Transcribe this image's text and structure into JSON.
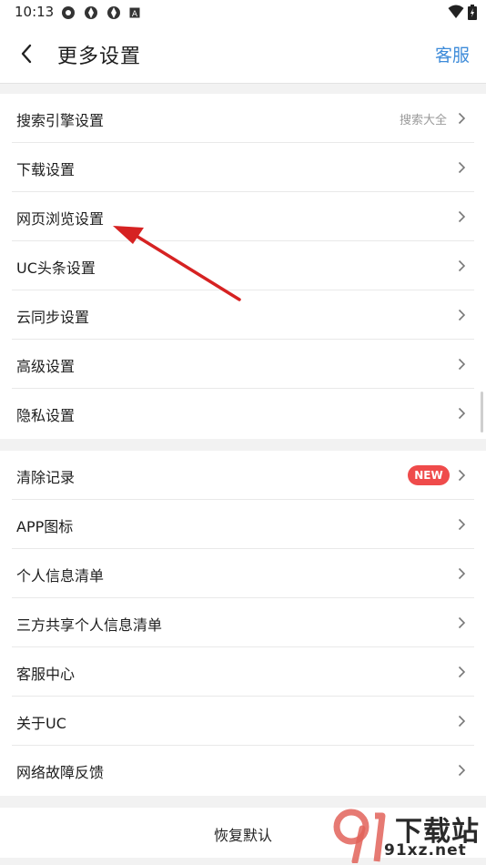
{
  "status_bar": {
    "time": "10:13"
  },
  "header": {
    "title": "更多设置",
    "service_label": "客服"
  },
  "group1": [
    {
      "label": "搜索引擎设置",
      "hint": "搜索大全"
    },
    {
      "label": "下载设置"
    },
    {
      "label": "网页浏览设置"
    },
    {
      "label": "UC头条设置"
    },
    {
      "label": "云同步设置"
    },
    {
      "label": "高级设置"
    },
    {
      "label": "隐私设置"
    }
  ],
  "group2": [
    {
      "label": "清除记录",
      "badge": "NEW"
    },
    {
      "label": "APP图标"
    },
    {
      "label": "个人信息清单"
    },
    {
      "label": "三方共享个人信息清单"
    },
    {
      "label": "客服中心"
    },
    {
      "label": "关于UC"
    },
    {
      "label": "网络故障反馈"
    }
  ],
  "footer": {
    "restore_label": "恢复默认"
  },
  "watermark": {
    "text_top": "下载站",
    "text_bottom": "91xz.net"
  },
  "colors": {
    "accent": "#3d8bd9",
    "badge": "#ef4b4b",
    "annotation_arrow": "#d62222"
  }
}
